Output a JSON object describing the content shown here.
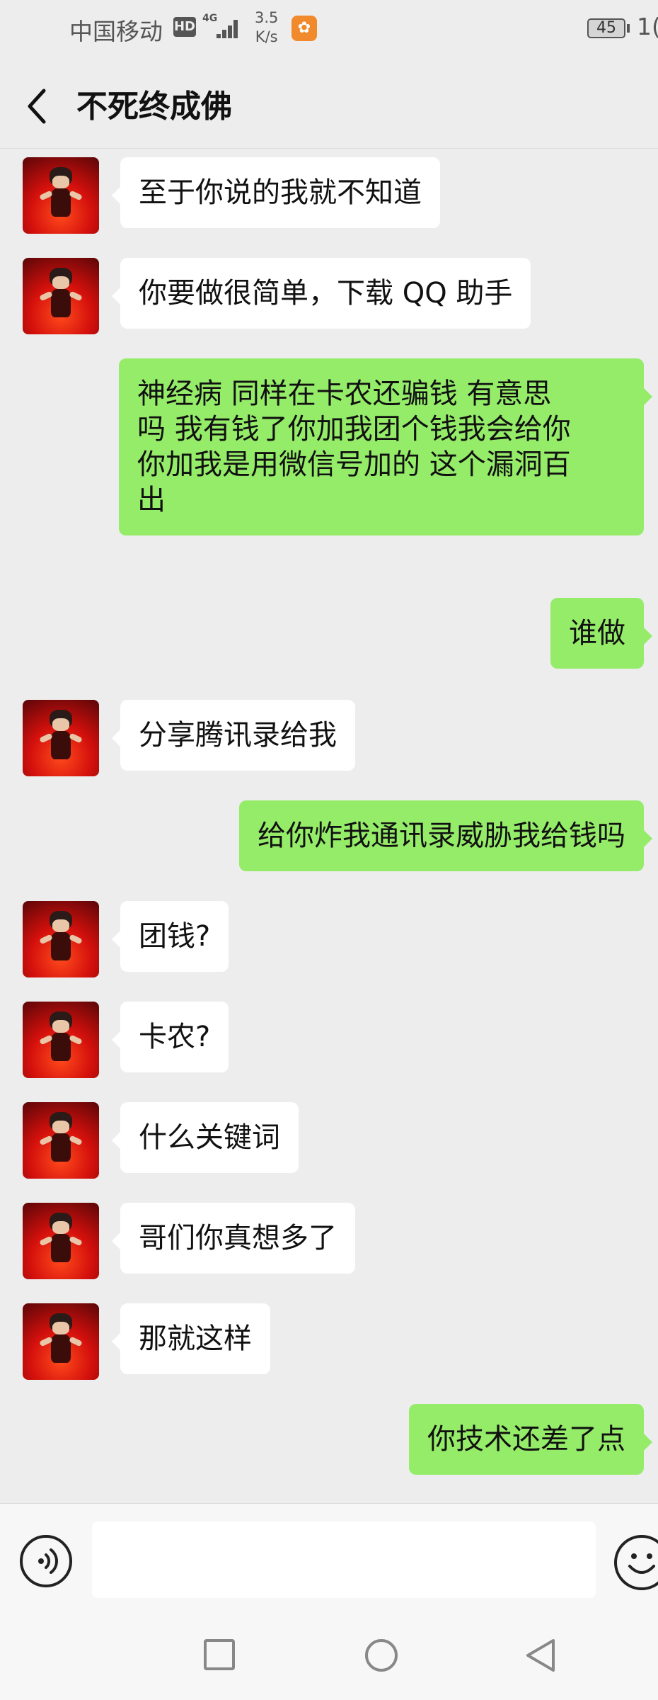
{
  "status_bar": {
    "carrier": "中国移动",
    "hd": "HD",
    "network": "4G",
    "speed_value": "3.5",
    "speed_unit": "K/s",
    "battery": "45",
    "clock": "1("
  },
  "header": {
    "title": "不死终成佛"
  },
  "messages": [
    {
      "side": "left",
      "text": "至于你说的我就不知道"
    },
    {
      "side": "left",
      "text": "你要做很简单，下载 QQ 助手"
    },
    {
      "side": "right",
      "line1": "神经病 同样在卡农还骗钱 有意思",
      "line2": "吗 我有钱了你加我团个钱我会给你",
      "line3": "你加我是用微信号加的 这个漏洞百",
      "line4": "出"
    },
    {
      "side": "right",
      "text": "谁做"
    },
    {
      "side": "left",
      "text": "分享腾讯录给我"
    },
    {
      "side": "right",
      "text": "给你炸我通讯录威胁我给钱吗"
    },
    {
      "side": "left",
      "text": "团钱?"
    },
    {
      "side": "left",
      "text": "卡农?"
    },
    {
      "side": "left",
      "text": "什么关键词"
    },
    {
      "side": "left",
      "text": "哥们你真想多了"
    },
    {
      "side": "left",
      "text": "那就这样"
    },
    {
      "side": "right",
      "text": "你技术还差了点"
    }
  ],
  "input_bar": {
    "value": "",
    "placeholder": ""
  },
  "icons": {
    "back": "chevron-left-icon",
    "voice": "voice-icon",
    "emoji": "emoji-icon",
    "recent": "square-icon",
    "home": "circle-icon",
    "nav_back": "triangle-back-icon"
  },
  "colors": {
    "background": "#ededed",
    "bubble_sent": "#95ec69",
    "bubble_received": "#ffffff",
    "uc_orange": "#f08a2c"
  }
}
